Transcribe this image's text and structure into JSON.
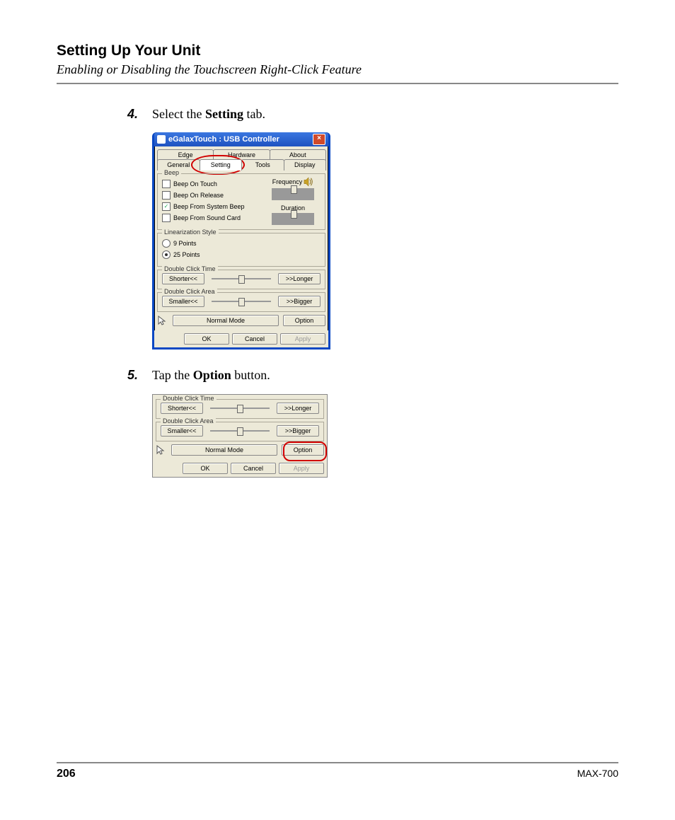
{
  "header": {
    "chapter": "Setting Up Your Unit",
    "section": "Enabling or Disabling the Touchscreen Right-Click Feature"
  },
  "steps": {
    "s4": {
      "num": "4.",
      "pre": "Select the ",
      "bold": "Setting",
      "post": " tab."
    },
    "s5": {
      "num": "5.",
      "pre": "Tap the ",
      "bold": "Option",
      "post": " button."
    }
  },
  "dialog1": {
    "title": "eGalaxTouch : USB Controller",
    "tabs_back": [
      "Edge Compensation",
      "Hardware",
      "About"
    ],
    "tabs_front": [
      "General",
      "Setting",
      "Tools",
      "Display"
    ],
    "beep": {
      "legend": "Beep",
      "onTouch": "Beep On Touch",
      "onRelease": "Beep On Release",
      "systemBeep": "Beep From System Beep",
      "soundCard": "Beep From Sound Card",
      "frequency": "Frequency",
      "duration": "Duration"
    },
    "lin": {
      "legend": "Linearization Style",
      "opt9": "9 Points",
      "opt25": "25 Points"
    },
    "dct": {
      "legend": "Double Click Time",
      "shorter": "Shorter<<",
      "longer": ">>Longer"
    },
    "dca": {
      "legend": "Double Click Area",
      "smaller": "Smaller<<",
      "bigger": ">>Bigger"
    },
    "mode": "Normal Mode",
    "option": "Option",
    "ok": "OK",
    "cancel": "Cancel",
    "apply": "Apply"
  },
  "footer": {
    "page": "206",
    "model": "MAX-700"
  }
}
